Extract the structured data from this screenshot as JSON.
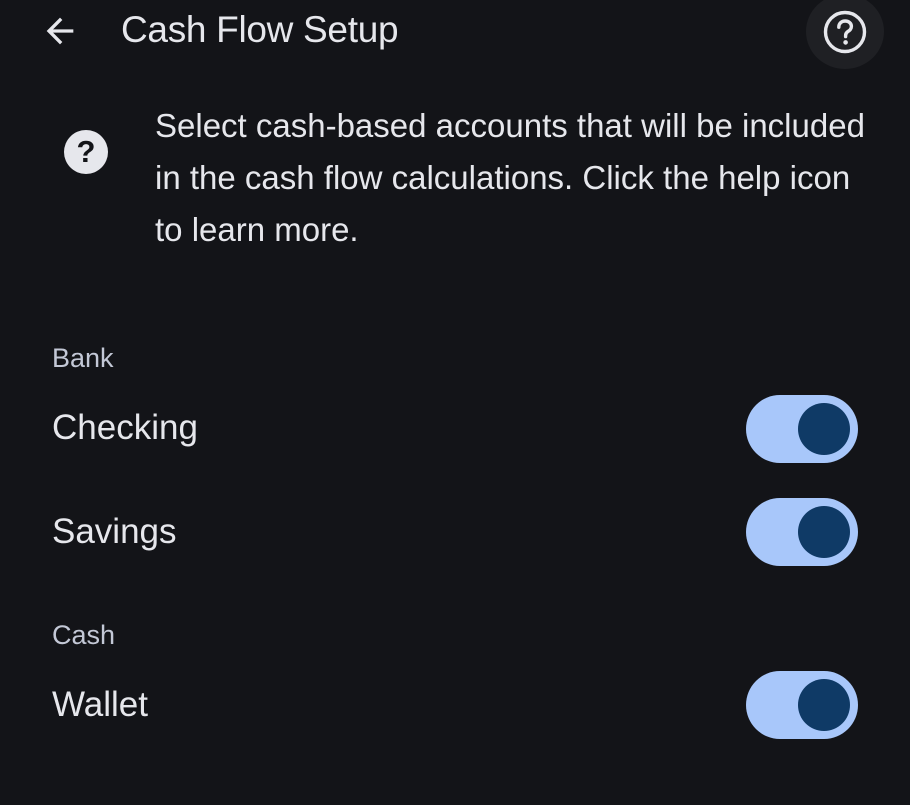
{
  "header": {
    "title": "Cash Flow Setup",
    "back_icon": "arrow-left-icon",
    "help_icon": "help-circle-icon"
  },
  "info": {
    "icon": "question-icon",
    "glyph": "?",
    "text": "Select cash-based accounts that will be included in the cash flow calculations. Click the help icon to learn more."
  },
  "sections": [
    {
      "label": "Bank",
      "items": [
        {
          "label": "Checking",
          "enabled": true
        },
        {
          "label": "Savings",
          "enabled": true
        }
      ]
    },
    {
      "label": "Cash",
      "items": [
        {
          "label": "Wallet",
          "enabled": true
        }
      ]
    }
  ],
  "colors": {
    "background": "#131418",
    "toggle_track_on": "#a8c7fa",
    "toggle_thumb_on": "#0f3a66",
    "text_primary": "#e6e7ec",
    "text_section": "#c3c8d6"
  }
}
